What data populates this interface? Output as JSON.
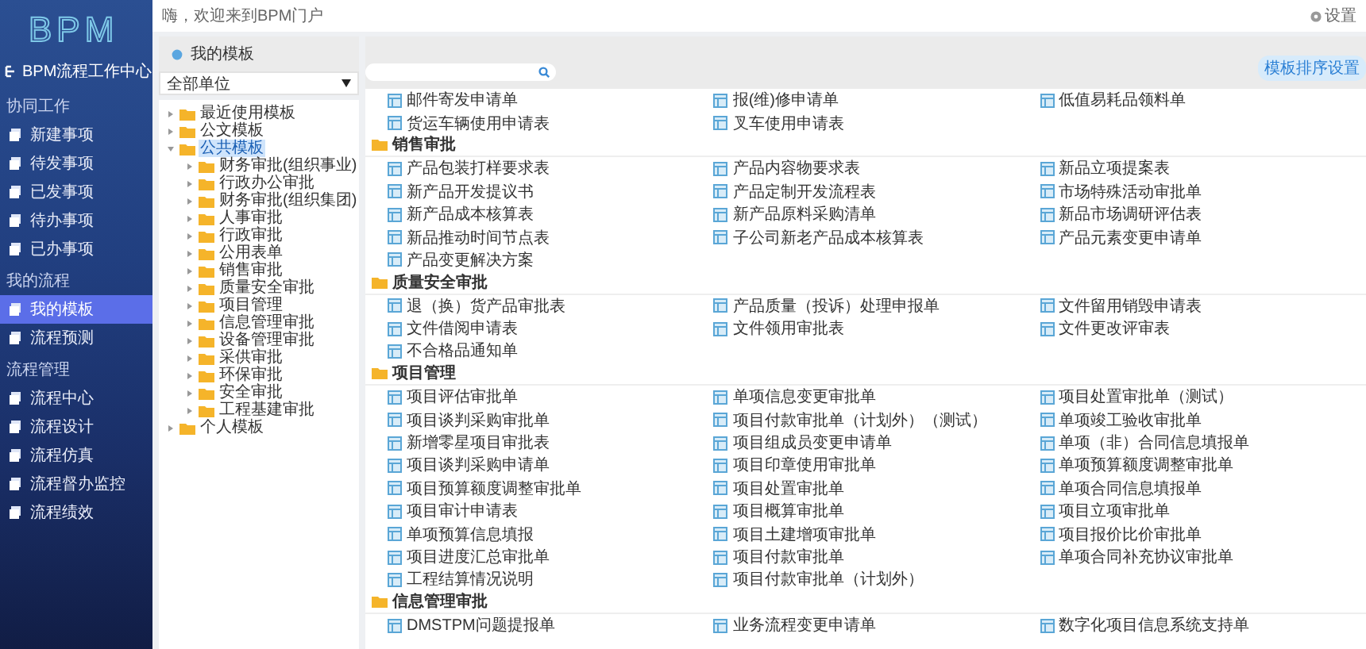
{
  "header": {
    "greeting": "嗨，欢迎来到BPM门户",
    "settings": "设置"
  },
  "sidebar": {
    "logo": "BPM",
    "home": "BPM流程工作中心",
    "sections": [
      {
        "title": "协同工作",
        "items": [
          {
            "label": "新建事项",
            "selected": false
          },
          {
            "label": "待发事项",
            "selected": false
          },
          {
            "label": "已发事项",
            "selected": false
          },
          {
            "label": "待办事项",
            "selected": false
          },
          {
            "label": "已办事项",
            "selected": false
          }
        ]
      },
      {
        "title": "我的流程",
        "items": [
          {
            "label": "我的模板",
            "selected": true
          },
          {
            "label": "流程预测",
            "selected": false
          }
        ]
      },
      {
        "title": "流程管理",
        "items": [
          {
            "label": "流程中心",
            "selected": false
          },
          {
            "label": "流程设计",
            "selected": false
          },
          {
            "label": "流程仿真",
            "selected": false
          },
          {
            "label": "流程督办监控",
            "selected": false
          },
          {
            "label": "流程绩效",
            "selected": false
          }
        ]
      }
    ]
  },
  "tree_panel": {
    "title": "我的模板",
    "unit_select": "全部单位",
    "tree": [
      {
        "label": "最近使用模板",
        "expanded": false,
        "selected": false
      },
      {
        "label": "公文模板",
        "expanded": false,
        "selected": false
      },
      {
        "label": "公共模板",
        "expanded": true,
        "selected": true,
        "children": [
          {
            "label": "财务审批(组织事业)",
            "expanded": false,
            "selected": false
          },
          {
            "label": "行政办公审批",
            "expanded": false,
            "selected": false
          },
          {
            "label": "财务审批(组织集团)",
            "expanded": false,
            "selected": false
          },
          {
            "label": "人事审批",
            "expanded": false,
            "selected": false
          },
          {
            "label": "行政审批",
            "expanded": false,
            "selected": false
          },
          {
            "label": "公用表单",
            "expanded": false,
            "selected": false
          },
          {
            "label": "销售审批",
            "expanded": false,
            "selected": false
          },
          {
            "label": "质量安全审批",
            "expanded": false,
            "selected": false
          },
          {
            "label": "项目管理",
            "expanded": false,
            "selected": false
          },
          {
            "label": "信息管理审批",
            "expanded": false,
            "selected": false
          },
          {
            "label": "设备管理审批",
            "expanded": false,
            "selected": false
          },
          {
            "label": "采供审批",
            "expanded": false,
            "selected": false
          },
          {
            "label": "环保审批",
            "expanded": false,
            "selected": false
          },
          {
            "label": "安全审批",
            "expanded": false,
            "selected": false
          },
          {
            "label": "工程基建审批",
            "expanded": false,
            "selected": false
          }
        ]
      },
      {
        "label": "个人模板",
        "expanded": false,
        "selected": false
      }
    ]
  },
  "main": {
    "sort_button": "模板排序设置",
    "groups": [
      {
        "items": [
          "邮件寄发申请单",
          "报(维)修申请单",
          "低值易耗品领料单",
          "货运车辆使用申请表",
          "叉车使用申请表"
        ]
      },
      {
        "title": "销售审批",
        "items": [
          "产品包装打样要求表",
          "产品内容物要求表",
          "新品立项提案表",
          "新产品开发提议书",
          "产品定制开发流程表",
          "市场特殊活动审批单",
          "新产品成本核算表",
          "新产品原料采购清单",
          "新品市场调研评估表",
          "新品推动时间节点表",
          "子公司新老产品成本核算表",
          "产品元素变更申请单",
          "产品变更解决方案"
        ]
      },
      {
        "title": "质量安全审批",
        "items": [
          "退（换）货产品审批表",
          "产品质量（投诉）处理申报单",
          "文件留用销毁申请表",
          "文件借阅申请表",
          "文件领用审批表",
          "文件更改评审表",
          "不合格品通知单"
        ]
      },
      {
        "title": "项目管理",
        "items": [
          "项目评估审批单",
          "单项信息变更审批单",
          "项目处置审批单（测试）",
          "项目谈判采购审批单",
          "项目付款审批单（计划外）（测试）",
          "单项竣工验收审批单",
          "新增零星项目审批表",
          "项目组成员变更申请单",
          "单项（非）合同信息填报单",
          "项目谈判采购申请单",
          "项目印章使用审批单",
          "单项预算额度调整审批单",
          "项目预算额度调整审批单",
          "项目处置审批单",
          "单项合同信息填报单",
          "项目审计申请表",
          "项目概算审批单",
          "项目立项审批单",
          "单项预算信息填报",
          "项目土建增项审批单",
          "项目报价比价审批单",
          "项目进度汇总审批单",
          "项目付款审批单",
          "单项合同补充协议审批单",
          "工程结算情况说明",
          "项目付款审批单（计划外）"
        ]
      },
      {
        "title": "信息管理审批",
        "items": [
          "DMSTPM问题提报单",
          "业务流程变更申请单",
          "数字化项目信息系统支持单"
        ]
      }
    ]
  }
}
